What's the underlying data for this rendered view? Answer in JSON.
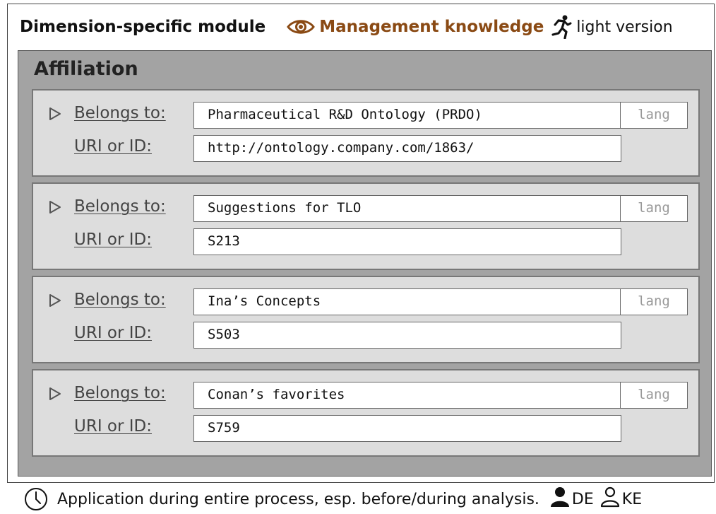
{
  "header": {
    "module_label": "Dimension-specific module",
    "eye_icon": "eye-icon",
    "category": "Management knowledge",
    "category_color": "#8a4a14",
    "runner_icon": "running-person-icon",
    "version": "light version"
  },
  "panel": {
    "title": "Affiliation",
    "background": "#a3a3a3",
    "entries": [
      {
        "belongs_label": "Belongs to:",
        "belongs_value": "Pharmaceutical R&D Ontology (PRDO)",
        "lang_placeholder": "lang",
        "uri_label": "URI or ID:",
        "uri_value": "http://ontology.company.com/1863/"
      },
      {
        "belongs_label": "Belongs to:",
        "belongs_value": "Suggestions for TLO",
        "lang_placeholder": "lang",
        "uri_label": "URI or ID:",
        "uri_value": "S213"
      },
      {
        "belongs_label": "Belongs to:",
        "belongs_value": "Ina’s Concepts",
        "lang_placeholder": "lang",
        "uri_label": "URI or ID:",
        "uri_value": "S503"
      },
      {
        "belongs_label": "Belongs to:",
        "belongs_value": "Conan’s favorites",
        "lang_placeholder": "lang",
        "uri_label": "URI or ID:",
        "uri_value": "S759"
      }
    ]
  },
  "footer": {
    "clock_icon": "clock-icon",
    "application_text": "Application during entire process, esp. before/during analysis.",
    "roles": [
      {
        "icon": "person-filled-icon",
        "label": "DE"
      },
      {
        "icon": "person-outline-icon",
        "label": "KE"
      }
    ]
  }
}
